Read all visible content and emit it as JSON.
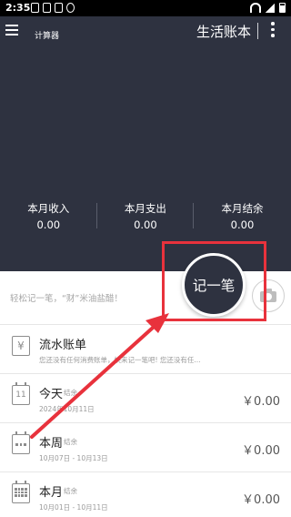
{
  "status_bar": {
    "time": "2:35"
  },
  "header": {
    "calculator_label": "计算器",
    "ledger_name": "生活账本"
  },
  "summary": [
    {
      "label": "本月收入",
      "value": "0.00"
    },
    {
      "label": "本月支出",
      "value": "0.00"
    },
    {
      "label": "本月结余",
      "value": "0.00"
    }
  ],
  "quick_entry": {
    "hint": "轻松记一笔，“财”米油盐醋！",
    "record_button": "记一笔"
  },
  "list": {
    "flow": {
      "title": "流水账单",
      "subtitle": "您还没有任何消费账单，快来记一笔吧! 您还没有任..."
    },
    "today": {
      "title": "今天",
      "tag": "结余",
      "date": "2024年10月11日",
      "amount": "￥0.00",
      "icon_day": "11"
    },
    "week": {
      "title": "本周",
      "tag": "结余",
      "date": "10月07日 - 10月13日",
      "amount": "￥0.00"
    },
    "month": {
      "title": "本月",
      "tag": "结余",
      "date": "10月01日 - 10月11日",
      "amount": "￥0.00"
    }
  },
  "colors": {
    "header_bg": "#2e3240",
    "annotation": "#e8323c"
  }
}
